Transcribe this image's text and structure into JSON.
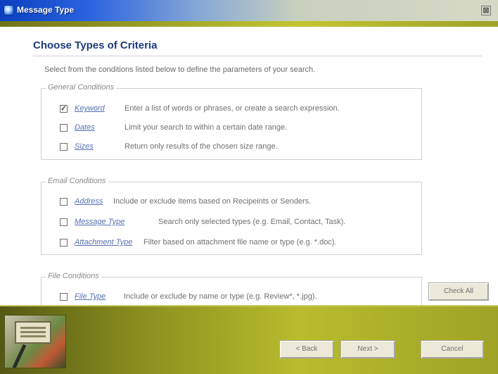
{
  "window": {
    "title": "Message Type",
    "close_glyph": "⊠"
  },
  "page": {
    "title": "Choose Types of Criteria",
    "instructions": "Select from the conditions listed below to define the parameters of your search."
  },
  "groups": {
    "general": {
      "legend": "General Conditions",
      "items": [
        {
          "label": "Keyword",
          "desc": "Enter a list of words or phrases, or create a search expression.",
          "checked": true,
          "mark": "☑"
        },
        {
          "label": "Dates",
          "desc": "Limit your search to within a certain date range.",
          "checked": false
        },
        {
          "label": "Sizes",
          "desc": "Return only results of the chosen size range.",
          "checked": false
        }
      ]
    },
    "email": {
      "legend": "Email Conditions",
      "items": [
        {
          "label": "Address",
          "desc": "Include or exclude items based on Recipeints or Senders.",
          "checked": false
        },
        {
          "label": "Message Type",
          "desc": "Search only selected types (e.g. Email, Contact, Task).",
          "checked": false
        },
        {
          "label": "Attachment Type",
          "desc": "Filter based on attachment file name or type (e.g. *.doc).",
          "checked": false
        }
      ]
    },
    "file": {
      "legend": "File Conditions",
      "items": [
        {
          "label": "File Type",
          "desc": "Include or exclude by name or type (e.g. Review*, *.jpg).",
          "checked": false
        }
      ]
    }
  },
  "buttons": {
    "check_all": "Check All",
    "back": "< Back",
    "next": "Next >",
    "cancel": "Cancel"
  },
  "icons": {
    "window_icon": "app-icon",
    "close_icon": "close-icon",
    "checkbox_mark": "✓"
  }
}
